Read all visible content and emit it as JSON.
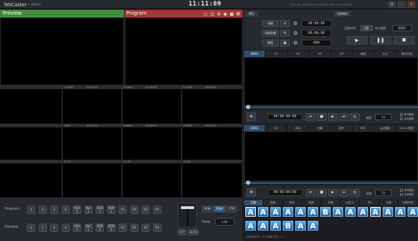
{
  "app": {
    "title": "NSCaster",
    "project": "---- demo",
    "clock": "11:11:09",
    "status_text": "CPU 18% MEM 47% NET 0 Mb/s 30fps 00:00:00 REC"
  },
  "preview": {
    "label": "Preview"
  },
  "program": {
    "label": "Program",
    "icons": "▢ ◫ ⚙ ◉ ▦ ✪"
  },
  "row1": [
    {
      "name": "",
      "tc": ""
    },
    {
      "name": "2.CAM2",
      "tc": "00:00:00"
    },
    {
      "name": "3.CAM3",
      "tc": "00:00:00"
    },
    {
      "name": "4.CAM4",
      "tc": "00:00:00"
    }
  ],
  "row2": [
    {
      "name": "",
      "tc": ""
    },
    {
      "name": "5.NET",
      "tc": "00:00:00"
    },
    {
      "name": "6.DDR1",
      "tc": "00:00:00"
    },
    {
      "name": "7.DDR2",
      "tc": "00:00:00"
    }
  ],
  "row3": [
    {
      "name": "",
      "tc": ""
    },
    {
      "name": "10.V2",
      "tc": ""
    },
    {
      "name": "11.V3",
      "tc": ""
    },
    {
      "name": "12.V4",
      "tc": ""
    }
  ],
  "switcher": {
    "program_label": "Program",
    "preview_label": "Preview",
    "buttons": [
      "1",
      "2",
      "3",
      "4",
      "VGA\n1",
      "Net\n1",
      "DDR\n1",
      "DDR\n2",
      "V1",
      "V2",
      "V3",
      "V4"
    ],
    "modes": [
      "PVW",
      "PGM",
      "FTB"
    ],
    "time_label": "Time",
    "time_value": "1.0s",
    "cut": "CUT",
    "auto": "AUTO"
  },
  "record": {
    "rec_label": "录像",
    "rec_tc": "00:00:00",
    "live_label": "网络直播",
    "live_tc": "00:00:00",
    "shot_label": "截图",
    "shot_tc": "000"
  },
  "playback": {
    "header_left": "播出",
    "header_right": "回放输出",
    "delay_label": "回放时间",
    "delay_value": "2秒",
    "safe_label": "安全播放",
    "source_value": "DDR1"
  },
  "ddr_tabs": [
    "DDR1",
    "V1",
    "V2",
    "V3",
    "V4",
    "播放",
    "空白",
    "素材列表"
  ],
  "ddr1": {
    "tc": "00:00:00:00",
    "speed_label": "速度",
    "speed_value": "1x",
    "opt1": "单次播放",
    "opt2": "自动播放"
  },
  "ddr2_tabs": [
    "DDR2",
    "CG",
    "网站",
    "字幕",
    "图片",
    "NET",
    "自动播放",
    "Live+播放"
  ],
  "ddr2": {
    "tc": "00:00:00:00",
    "speed_label": "速度",
    "speed_value": "1x",
    "opt1": "单次播放",
    "opt2": "自动播放"
  },
  "trans_tabs": [
    "切换",
    "划像",
    "推拉",
    "旋转",
    "特殊",
    "自定义",
    "3D",
    "字幕",
    "快捷特效"
  ],
  "trans_tiles": [
    "A",
    "A",
    "A",
    "A",
    "A",
    "A",
    "B",
    "A",
    "A",
    "A",
    "A",
    "A",
    "A",
    "A",
    "A",
    "A",
    "A",
    "B",
    "A",
    "A"
  ],
  "footer": "当前选择特效：交叉溶解   时长：1.0"
}
